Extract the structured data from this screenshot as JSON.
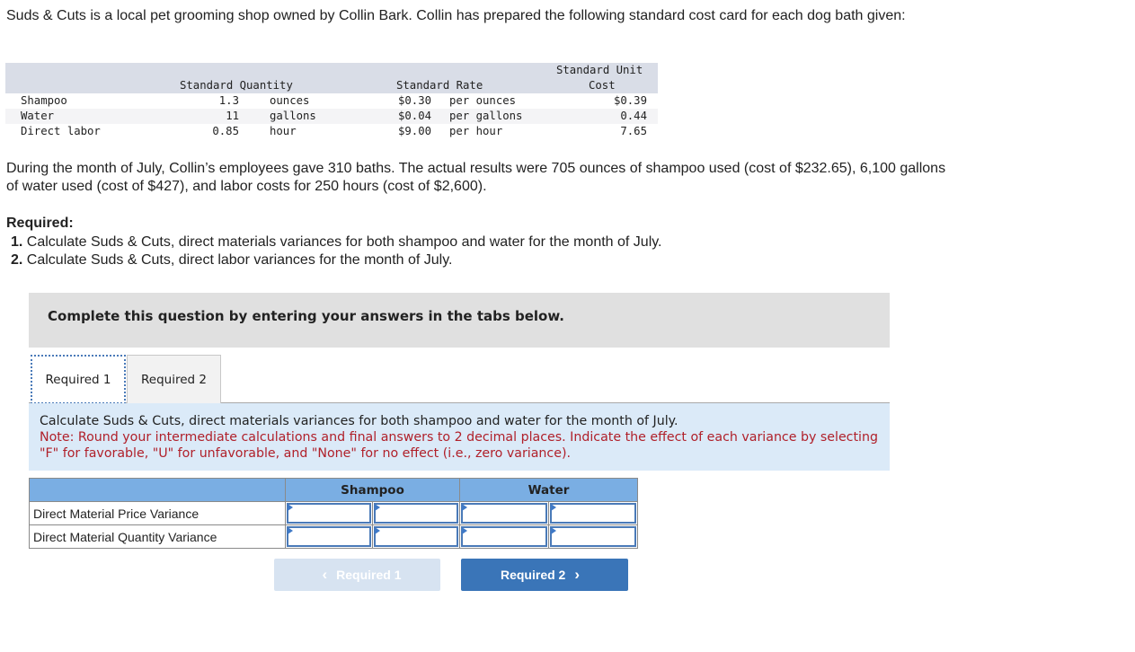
{
  "intro": "Suds & Cuts is a local pet grooming shop owned by Collin Bark. Collin has prepared the following standard cost card for each dog bath given:",
  "cost_card": {
    "headers": {
      "quantity": "Standard Quantity",
      "rate": "Standard Rate",
      "unit_cost_line1": "Standard Unit",
      "unit_cost_line2": "Cost"
    },
    "rows": [
      {
        "name": "Shampoo",
        "qty": "1.3",
        "qty_unit": "ounces",
        "rate": "$0.30",
        "rate_unit": "per ounces",
        "cost": "$0.39"
      },
      {
        "name": "Water",
        "qty": "11",
        "qty_unit": "gallons",
        "rate": "$0.04",
        "rate_unit": "per gallons",
        "cost": "0.44"
      },
      {
        "name": "Direct labor",
        "qty": "0.85",
        "qty_unit": "hour",
        "rate": "$9.00",
        "rate_unit": "per hour",
        "cost": "7.65"
      }
    ]
  },
  "paragraph": "During the month of July, Collin’s employees gave 310 baths. The actual results were 705 ounces of shampoo used (cost of $232.65), 6,100 gallons of water used (cost of $427), and labor costs for 250 hours (cost of $2,600).",
  "required": {
    "title": "Required:",
    "items": [
      {
        "num": "1.",
        "text": " Calculate Suds & Cuts, direct materials variances for both shampoo and water for the month of July."
      },
      {
        "num": "2.",
        "text": " Calculate Suds & Cuts, direct labor variances for the month of July."
      }
    ]
  },
  "banner": "Complete this question by entering your answers in the tabs below.",
  "tabs": [
    {
      "label": "Required 1",
      "active": true
    },
    {
      "label": "Required 2",
      "active": false
    }
  ],
  "instructions": {
    "main": "Calculate Suds & Cuts, direct materials variances for both shampoo and water for the month of July.",
    "note": "Note: Round your intermediate calculations and final answers to 2 decimal places. Indicate the effect of each variance by selecting \"F\" for favorable, \"U\" for unfavorable, and \"None\" for no effect (i.e., zero variance)."
  },
  "answer_table": {
    "columns": [
      "Shampoo",
      "Water"
    ],
    "rows": [
      {
        "label": "Direct Material Price Variance",
        "shampoo_amount": "",
        "shampoo_effect": "",
        "water_amount": "",
        "water_effect": ""
      },
      {
        "label": "Direct Material Quantity Variance",
        "shampoo_amount": "",
        "shampoo_effect": "",
        "water_amount": "",
        "water_effect": ""
      }
    ]
  },
  "nav": {
    "prev_label": "Required 1",
    "next_label": "Required 2",
    "prev_icon": "chevron-left-icon",
    "next_icon": "chevron-right-icon"
  }
}
